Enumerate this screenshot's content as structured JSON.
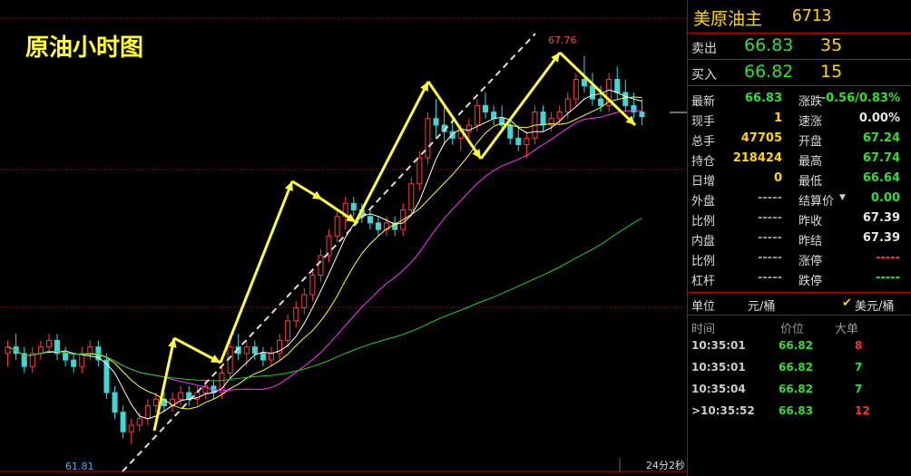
{
  "chart_title": "原油小时图",
  "chart_data": {
    "type": "candlestick",
    "title": "原油小时图",
    "high_label": "67.76",
    "low_label": "61.81",
    "ylim": [
      61.6,
      68.2
    ],
    "countdown": "24分2秒",
    "candles": [
      [
        63.2,
        63.4,
        63.0,
        63.3
      ],
      [
        63.3,
        63.5,
        63.1,
        63.2
      ],
      [
        63.2,
        63.3,
        62.9,
        63.0
      ],
      [
        63.0,
        63.3,
        62.9,
        63.2
      ],
      [
        63.2,
        63.4,
        63.1,
        63.3
      ],
      [
        63.3,
        63.5,
        63.2,
        63.4
      ],
      [
        63.4,
        63.5,
        63.1,
        63.2
      ],
      [
        63.2,
        63.3,
        63.0,
        63.1
      ],
      [
        63.1,
        63.2,
        62.9,
        63.0
      ],
      [
        63.0,
        63.3,
        62.9,
        63.2
      ],
      [
        63.2,
        63.4,
        63.1,
        63.3
      ],
      [
        63.3,
        63.4,
        63.0,
        63.1
      ],
      [
        63.1,
        63.2,
        62.5,
        62.6
      ],
      [
        62.6,
        62.7,
        62.2,
        62.3
      ],
      [
        62.3,
        62.4,
        61.9,
        62.0
      ],
      [
        62.0,
        62.2,
        61.81,
        62.1
      ],
      [
        62.1,
        62.3,
        62.0,
        62.2
      ],
      [
        62.2,
        62.5,
        62.1,
        62.4
      ],
      [
        62.4,
        62.6,
        62.3,
        62.5
      ],
      [
        62.5,
        62.6,
        62.3,
        62.4
      ],
      [
        62.4,
        62.6,
        62.3,
        62.5
      ],
      [
        62.5,
        62.7,
        62.4,
        62.6
      ],
      [
        62.6,
        62.7,
        62.4,
        62.5
      ],
      [
        62.5,
        62.7,
        62.4,
        62.6
      ],
      [
        62.6,
        62.8,
        62.5,
        62.7
      ],
      [
        62.7,
        62.8,
        62.5,
        62.6
      ],
      [
        62.6,
        63.0,
        62.5,
        62.9
      ],
      [
        62.9,
        63.4,
        62.8,
        63.3
      ],
      [
        63.3,
        63.5,
        63.1,
        63.2
      ],
      [
        63.2,
        63.4,
        63.0,
        63.3
      ],
      [
        63.3,
        63.4,
        63.1,
        63.2
      ],
      [
        63.2,
        63.3,
        63.0,
        63.1
      ],
      [
        63.1,
        63.3,
        63.0,
        63.2
      ],
      [
        63.2,
        63.5,
        63.1,
        63.4
      ],
      [
        63.4,
        63.8,
        63.3,
        63.7
      ],
      [
        63.7,
        64.0,
        63.6,
        63.9
      ],
      [
        63.9,
        64.2,
        63.8,
        64.1
      ],
      [
        64.1,
        64.5,
        64.0,
        64.4
      ],
      [
        64.4,
        64.8,
        64.3,
        64.7
      ],
      [
        64.7,
        65.1,
        64.6,
        65.0
      ],
      [
        65.0,
        65.4,
        64.9,
        65.3
      ],
      [
        65.3,
        65.6,
        65.1,
        65.5
      ],
      [
        65.5,
        65.6,
        65.3,
        65.4
      ],
      [
        65.4,
        65.5,
        65.2,
        65.3
      ],
      [
        65.3,
        65.4,
        65.1,
        65.2
      ],
      [
        65.2,
        65.3,
        65.0,
        65.1
      ],
      [
        65.1,
        65.3,
        65.0,
        65.2
      ],
      [
        65.2,
        65.3,
        65.0,
        65.1
      ],
      [
        65.1,
        65.5,
        65.0,
        65.4
      ],
      [
        65.4,
        65.9,
        65.3,
        65.8
      ],
      [
        65.8,
        66.3,
        65.7,
        66.2
      ],
      [
        66.2,
        66.9,
        66.1,
        66.8
      ],
      [
        66.8,
        67.1,
        66.5,
        66.7
      ],
      [
        66.7,
        67.0,
        66.4,
        66.6
      ],
      [
        66.6,
        66.8,
        66.4,
        66.5
      ],
      [
        66.5,
        66.7,
        66.3,
        66.6
      ],
      [
        66.6,
        66.8,
        66.5,
        66.7
      ],
      [
        66.7,
        67.1,
        66.6,
        67.0
      ],
      [
        67.0,
        67.2,
        66.8,
        66.9
      ],
      [
        66.9,
        67.0,
        66.7,
        66.8
      ],
      [
        66.8,
        67.0,
        66.6,
        66.7
      ],
      [
        66.7,
        66.8,
        66.4,
        66.5
      ],
      [
        66.5,
        66.7,
        66.3,
        66.4
      ],
      [
        66.4,
        66.6,
        66.2,
        66.5
      ],
      [
        66.5,
        67.0,
        66.4,
        66.9
      ],
      [
        66.9,
        67.0,
        66.6,
        66.7
      ],
      [
        66.7,
        66.9,
        66.6,
        66.8
      ],
      [
        66.8,
        67.0,
        66.7,
        66.9
      ],
      [
        66.9,
        67.2,
        66.8,
        67.1
      ],
      [
        67.1,
        67.5,
        67.0,
        67.4
      ],
      [
        67.4,
        67.76,
        67.2,
        67.3
      ],
      [
        67.3,
        67.5,
        67.0,
        67.1
      ],
      [
        67.1,
        67.3,
        66.9,
        67.0
      ],
      [
        67.0,
        67.5,
        66.9,
        67.4
      ],
      [
        67.4,
        67.6,
        67.1,
        67.2
      ],
      [
        67.2,
        67.4,
        66.9,
        67.0
      ],
      [
        67.0,
        67.2,
        66.8,
        66.9
      ],
      [
        66.9,
        67.1,
        66.7,
        66.83
      ]
    ]
  },
  "quote": {
    "name": "美原油主",
    "code": "6713",
    "sell_label": "卖出",
    "sell_price": "66.83",
    "sell_vol": "35",
    "buy_label": "买入",
    "buy_price": "66.82",
    "buy_vol": "15",
    "rows": [
      {
        "l": "最新",
        "v": "66.83",
        "vc": "g",
        "l2": "涨跌",
        "v2": "-0.56/0.83%",
        "v2c": "g"
      },
      {
        "l": "现手",
        "v": "1",
        "vc": "y",
        "l2": "速涨",
        "v2": "0.00%",
        "v2c": "w"
      },
      {
        "l": "总手",
        "v": "47705",
        "vc": "y",
        "l2": "开盘",
        "v2": "67.24",
        "v2c": "g"
      },
      {
        "l": "持仓",
        "v": "218424",
        "vc": "y",
        "l2": "最高",
        "v2": "67.74",
        "v2c": "g"
      },
      {
        "l": "日增",
        "v": "0",
        "vc": "y",
        "l2": "最低",
        "v2": "66.64",
        "v2c": "g"
      },
      {
        "l": "外盘",
        "v": "-----",
        "vc": "d",
        "l2": "结算价",
        "v2": "0.00",
        "v2c": "g"
      },
      {
        "l": "比例",
        "v": "-----",
        "vc": "d",
        "l2": "昨收",
        "v2": "67.39",
        "v2c": "w"
      },
      {
        "l": "内盘",
        "v": "-----",
        "vc": "d",
        "l2": "昨结",
        "v2": "67.39",
        "v2c": "w"
      },
      {
        "l": "比例",
        "v": "-----",
        "vc": "d",
        "l2": "涨停",
        "v2": "-----",
        "v2c": "r"
      },
      {
        "l": "杠杆",
        "v": "-----",
        "vc": "d",
        "l2": "跌停",
        "v2": "-----",
        "v2c": "g"
      }
    ],
    "unit_label": "单位",
    "unit_value": "元/桶",
    "unit_alt": "美元/桶",
    "trades_header": {
      "time": "时间",
      "price": "价位",
      "big": "大单"
    },
    "trades": [
      {
        "time": "10:35:01",
        "price": "66.82",
        "big": "8",
        "bc": "r"
      },
      {
        "time": "10:35:01",
        "price": "66.82",
        "big": "7",
        "bc": "g"
      },
      {
        "time": "10:35:04",
        "price": "66.82",
        "big": "7",
        "bc": "g"
      },
      {
        "time": ">10:35:52",
        "price": "66.83",
        "big": "12",
        "bc": "r"
      }
    ]
  }
}
